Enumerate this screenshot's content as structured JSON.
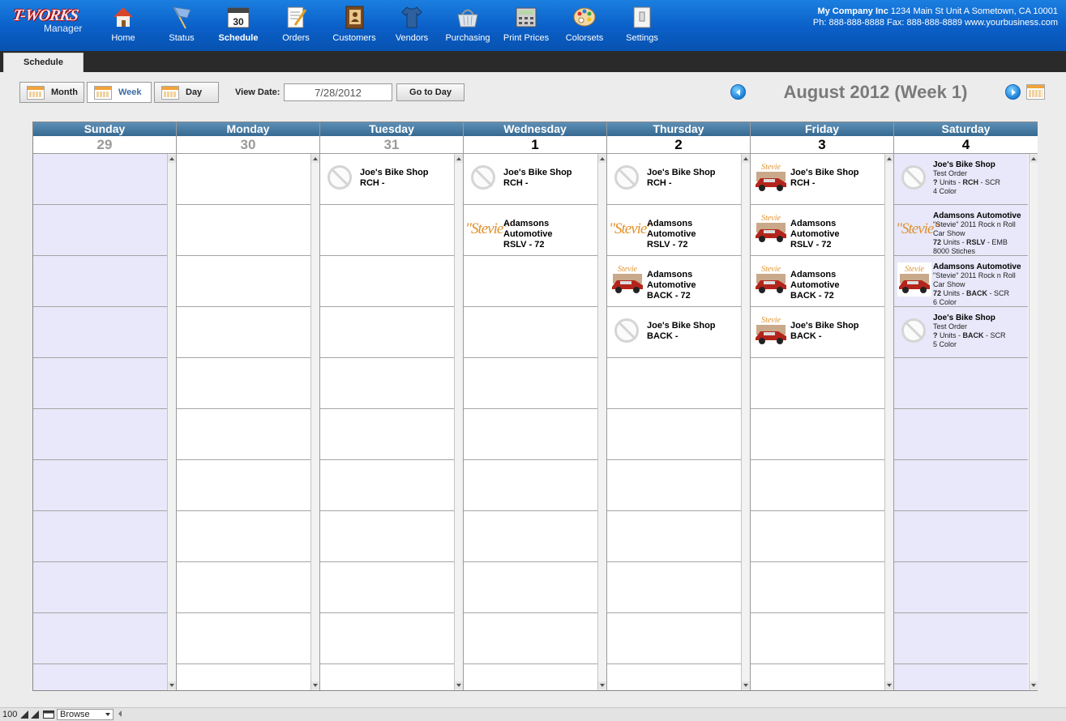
{
  "app": {
    "logo_text": "T-WORKS",
    "logo_sub": "Manager"
  },
  "nav": [
    {
      "label": "Home",
      "icon": "home-icon"
    },
    {
      "label": "Status",
      "icon": "flag-icon"
    },
    {
      "label": "Schedule",
      "icon": "calendar-icon",
      "day": "30"
    },
    {
      "label": "Orders",
      "icon": "orders-icon"
    },
    {
      "label": "Customers",
      "icon": "address-book-icon"
    },
    {
      "label": "Vendors",
      "icon": "shirt-icon"
    },
    {
      "label": "Purchasing",
      "icon": "basket-icon"
    },
    {
      "label": "Print Prices",
      "icon": "calculator-icon"
    },
    {
      "label": "Colorsets",
      "icon": "palette-icon"
    },
    {
      "label": "Settings",
      "icon": "switch-icon"
    }
  ],
  "company": {
    "name": "My Company Inc",
    "address": "1234 Main St Unit A Sometown, CA 10001",
    "contact": "Ph: 888-888-8888 Fax: 888-888-8889 www.yourbusiness.com"
  },
  "tabs": {
    "active": "Schedule"
  },
  "toolbar": {
    "month": "Month",
    "week": "Week",
    "day": "Day",
    "view_date_label": "View Date:",
    "view_date_value": "7/28/2012",
    "goto": "Go to Day",
    "period_title": "August 2012 (Week 1)"
  },
  "days": [
    {
      "name": "Sunday",
      "num": "29",
      "dim": true,
      "weekend": true
    },
    {
      "name": "Monday",
      "num": "30",
      "dim": true,
      "weekend": false
    },
    {
      "name": "Tuesday",
      "num": "31",
      "dim": true,
      "weekend": false
    },
    {
      "name": "Wednesday",
      "num": "1",
      "dim": false,
      "weekend": false
    },
    {
      "name": "Thursday",
      "num": "2",
      "dim": false,
      "weekend": false
    },
    {
      "name": "Friday",
      "num": "3",
      "dim": false,
      "weekend": false
    },
    {
      "name": "Saturday",
      "num": "4",
      "dim": false,
      "weekend": true
    }
  ],
  "events": {
    "tue": [
      {
        "thumb": "noimg",
        "lines": [
          "Joe's Bike Shop",
          "RCH  -"
        ]
      }
    ],
    "wed": [
      {
        "thumb": "noimg",
        "lines": [
          "Joe's Bike Shop",
          "RCH  -"
        ]
      },
      {
        "thumb": "stevie",
        "thumb_text": "\"Stevie\"",
        "lines": [
          "Adamsons",
          "Automotive",
          "RSLV  -  72"
        ]
      }
    ],
    "thu": [
      {
        "thumb": "noimg",
        "lines": [
          "Joe's Bike Shop",
          "RCH  -"
        ]
      },
      {
        "thumb": "stevie",
        "thumb_text": "\"Stevie\"",
        "lines": [
          "Adamsons",
          "Automotive",
          "RSLV  -  72"
        ]
      },
      {
        "thumb": "car",
        "lines": [
          "Adamsons",
          "Automotive",
          "BACK  -  72"
        ]
      },
      {
        "thumb": "noimg",
        "lines": [
          "Joe's Bike Shop",
          "BACK  -"
        ]
      }
    ],
    "fri": [
      {
        "thumb": "car",
        "lines": [
          "Joe's Bike Shop",
          "RCH  -"
        ]
      },
      {
        "thumb": "car",
        "lines": [
          "Adamsons",
          "Automotive",
          "RSLV  -  72"
        ]
      },
      {
        "thumb": "car",
        "lines": [
          "Adamsons",
          "Automotive",
          "BACK  -  72"
        ]
      },
      {
        "thumb": "car",
        "lines": [
          "Joe's Bike Shop",
          "BACK  -"
        ]
      }
    ],
    "sat": [
      {
        "thumb": "noimg",
        "name": "Joe's Bike Shop",
        "desc": "Test Order",
        "qty": "?",
        "loc": "RCH",
        "method": "SCR",
        "extra": "4 Color"
      },
      {
        "thumb": "stevie",
        "thumb_text": "\"Stevie\"",
        "name": "Adamsons Automotive",
        "desc": "\"Stevie\" 2011 Rock n Roll Car Show",
        "qty": "72",
        "loc": "RSLV",
        "method": "EMB",
        "extra": "8000 Stiches"
      },
      {
        "thumb": "car",
        "name": "Adamsons Automotive",
        "desc": "\"Stevie\" 2011 Rock n Roll Car Show",
        "qty": "72",
        "loc": "BACK",
        "method": "SCR",
        "extra": "6 Color"
      },
      {
        "thumb": "noimg",
        "name": "Joe's Bike Shop",
        "desc": "Test Order",
        "qty": "?",
        "loc": "BACK",
        "method": "SCR",
        "extra": "5 Color"
      }
    ],
    "units_label": "Units"
  },
  "statusbar": {
    "zoom": "100",
    "mode": "Browse"
  },
  "colors": {
    "topbar": "#0a5fc7",
    "header": "#366a92",
    "weekend": "#e8e8fa",
    "stevie": "#e0912b"
  }
}
